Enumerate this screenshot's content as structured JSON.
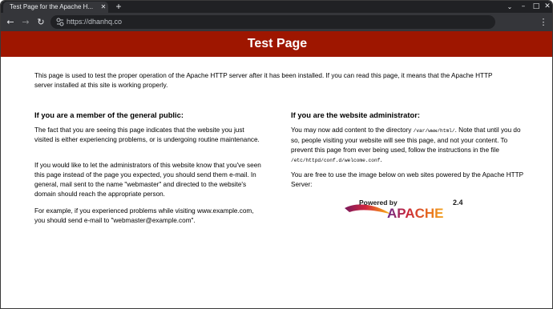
{
  "browser": {
    "tab": {
      "title": "Test Page for the Apache H...",
      "close_glyph": "✕"
    },
    "new_tab_glyph": "+",
    "tab_dropdown_glyph": "⌄",
    "window_controls": {
      "minimize": "–",
      "maximize": "□",
      "close": "✕"
    },
    "nav": {
      "back": "←",
      "forward": "→",
      "reload": "↻"
    },
    "address": "https://dhanhq.co",
    "menu_glyph": "⋮",
    "colors": {
      "frame": "#202124",
      "toolbar": "#35363a",
      "text": "#e8eaed"
    }
  },
  "page": {
    "banner_color": "#9e1600",
    "title": "Test Page",
    "intro": "This page is used to test the proper operation of the Apache HTTP server after it has been installed. If you can read this page, it means that the Apache HTTP server installed at this site is working properly.",
    "left": {
      "heading": "If you are a member of the general public:",
      "p1": "The fact that you are seeing this page indicates that the website you just visited is either experiencing problems, or is undergoing routine maintenance.",
      "p2": "If you would like to let the administrators of this website know that you've seen this page instead of the page you expected, you should send them e-mail. In general, mail sent to the name \"webmaster\" and directed to the website's domain should reach the appropriate person.",
      "p3": "For example, if you experienced problems while visiting www.example.com, you should send e-mail to \"webmaster@example.com\"."
    },
    "right": {
      "heading": "If you are the website administrator:",
      "p1_before": "You may now add content to the directory ",
      "p1_code": "/var/www/html/",
      "p1_middle": ". Note that until you do so, people visiting your website will see this page, and not your content. To prevent this page from ever being used, follow the instructions in the file ",
      "p1_file": "/etc/httpd/conf.d/welcome.conf",
      "p1_end": ".",
      "p2": "You are free to use the image below on web sites powered by the Apache HTTP Server:"
    },
    "logo": {
      "powered_by": "Powered by",
      "name": "APACHE",
      "version": "2.4"
    }
  }
}
